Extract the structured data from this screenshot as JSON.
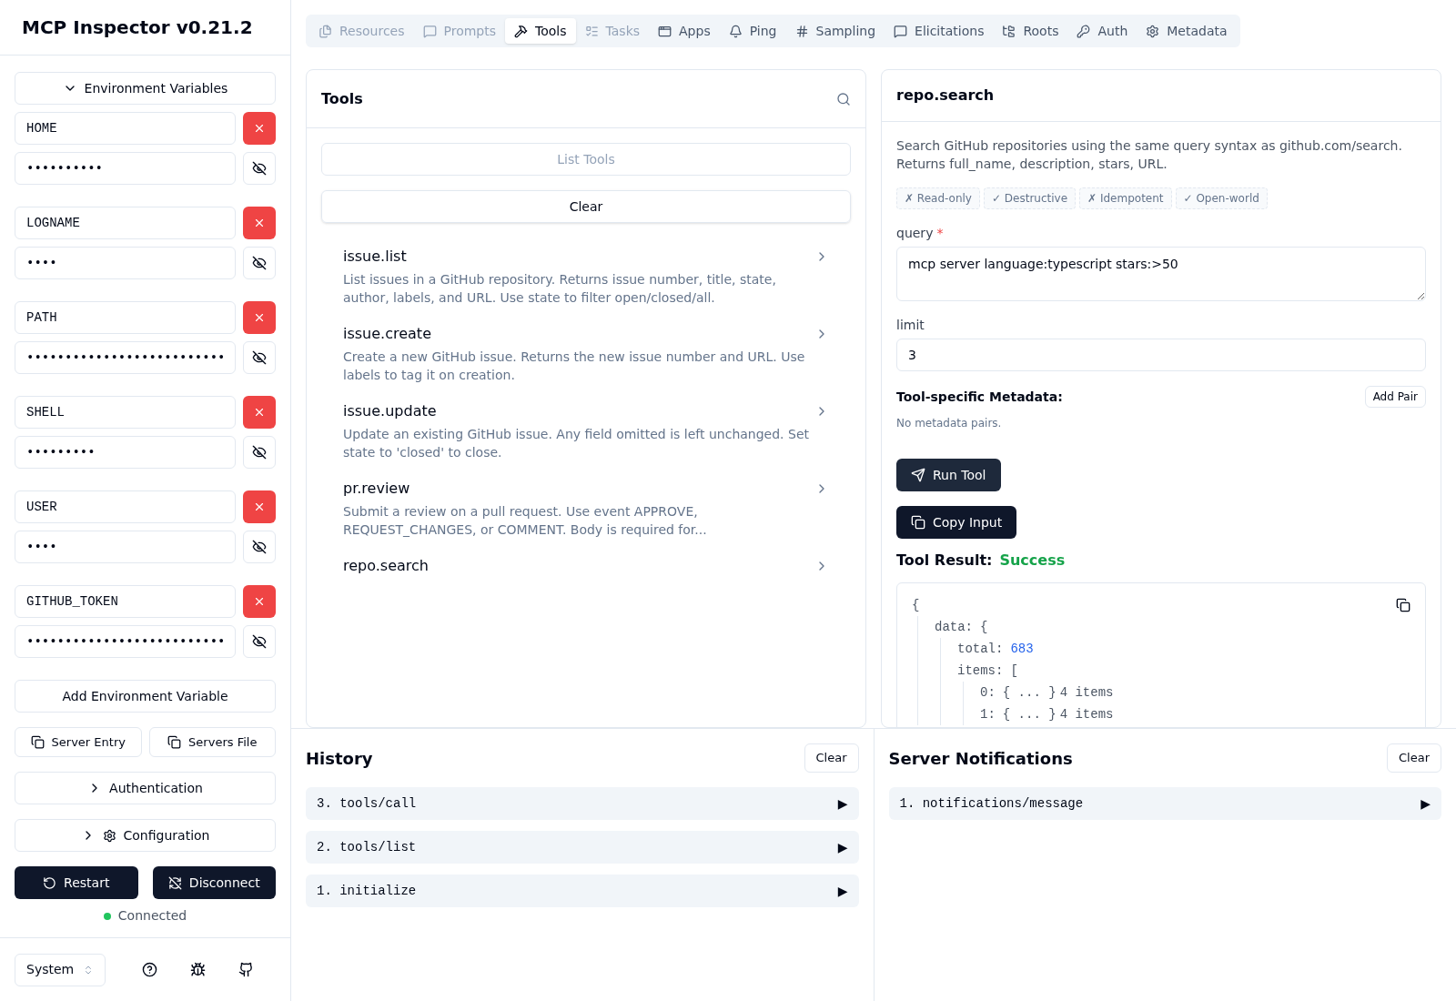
{
  "sidebar": {
    "title": "MCP Inspector v0.21.2",
    "env_toggle": {
      "label": "Environment Variables",
      "expanded": true
    },
    "env_vars": [
      {
        "key": "HOME",
        "value": "••••••••••"
      },
      {
        "key": "LOGNAME",
        "value": "••••"
      },
      {
        "key": "PATH",
        "value": "••••••••••••••••••••••••••"
      },
      {
        "key": "SHELL",
        "value": "•••••••••"
      },
      {
        "key": "USER",
        "value": "••••"
      },
      {
        "key": "GITHUB_TOKEN",
        "value": "••••••••••••••••••••••••••"
      }
    ],
    "add_env": "Add Environment Variable",
    "copy_buttons": [
      "Server Entry",
      "Servers File"
    ],
    "sections": [
      {
        "label": "Authentication",
        "expanded": false,
        "kind": "plain"
      },
      {
        "label": "Configuration",
        "expanded": false,
        "kind": "settings"
      }
    ],
    "actions": [
      "Restart",
      "Disconnect"
    ],
    "status": {
      "label": "Connected",
      "connected": true
    },
    "theme": "System"
  },
  "tabs": [
    {
      "label": "Resources",
      "selected": false,
      "disabled": true
    },
    {
      "label": "Prompts",
      "selected": false,
      "disabled": true
    },
    {
      "label": "Tools",
      "selected": true,
      "disabled": false
    },
    {
      "label": "Tasks",
      "selected": false,
      "disabled": true
    },
    {
      "label": "Apps",
      "selected": false,
      "disabled": false
    },
    {
      "label": "Ping",
      "selected": false,
      "disabled": false
    },
    {
      "label": "Sampling",
      "selected": false,
      "disabled": false
    },
    {
      "label": "Elicitations",
      "selected": false,
      "disabled": false
    },
    {
      "label": "Roots",
      "selected": false,
      "disabled": false
    },
    {
      "label": "Auth",
      "selected": false,
      "disabled": false
    },
    {
      "label": "Metadata",
      "selected": false,
      "disabled": false
    }
  ],
  "tools_panel": {
    "title": "Tools",
    "list_button": "List Tools",
    "clear_button": "Clear",
    "tools": [
      {
        "name": "issue.list",
        "description": "List issues in a GitHub repository. Returns issue number, title, state, author, labels, and URL. Use state to filter open/closed/all."
      },
      {
        "name": "issue.create",
        "description": "Create a new GitHub issue. Returns the new issue number and URL. Use labels to tag it on creation."
      },
      {
        "name": "issue.update",
        "description": "Update an existing GitHub issue. Any field omitted is left unchanged. Set state to 'closed' to close."
      },
      {
        "name": "pr.review",
        "description": "Submit a review on a pull request. Use event APPROVE, REQUEST_CHANGES, or COMMENT. Body is required for..."
      },
      {
        "name": "repo.search"
      }
    ]
  },
  "tool_detail": {
    "title": "repo.search",
    "description": "Search GitHub repositories using the same query syntax as github.com/search. Returns full_name, description, stars, URL.",
    "annotations": [
      "✗ Read-only",
      "✓ Destructive",
      "✗ Idempotent",
      "✓ Open-world"
    ],
    "params": [
      {
        "label": "query",
        "required_mark": "*",
        "kind": "textarea",
        "value": "mcp server language:typescript stars:>50"
      },
      {
        "label": "limit",
        "kind": "input",
        "value": "3"
      }
    ],
    "metadata_label": "Tool-specific Metadata:",
    "add_pair": "Add Pair",
    "metadata_empty": "No metadata pairs.",
    "run_button": "Run Tool",
    "copy_button": "Copy Input",
    "result_label": "Tool Result:",
    "result_status": {
      "label": "Success",
      "kind": "success"
    },
    "result_json": {
      "open": "{",
      "children": [
        {
          "key": "data:",
          "open": "{",
          "children": [
            {
              "key": "total:",
              "value": "683",
              "kind": "number"
            },
            {
              "key": "items:",
              "open": "[",
              "children": [
                {
                  "key": "0:",
                  "value": "{ ... }",
                  "count": "4 items"
                },
                {
                  "key": "1:",
                  "value": "{ ... }",
                  "count": "4 items"
                }
              ]
            }
          ]
        }
      ]
    }
  },
  "history": {
    "title": "History",
    "clear_button": "Clear",
    "entries": [
      {
        "label": "3. tools/call",
        "arrow": "▶"
      },
      {
        "label": "2. tools/list",
        "arrow": "▶"
      },
      {
        "label": "1. initialize",
        "arrow": "▶"
      }
    ]
  },
  "notifications": {
    "title": "Server Notifications",
    "clear_button": "Clear",
    "entries": [
      {
        "label": "1. notifications/message",
        "arrow": "▶"
      }
    ]
  }
}
